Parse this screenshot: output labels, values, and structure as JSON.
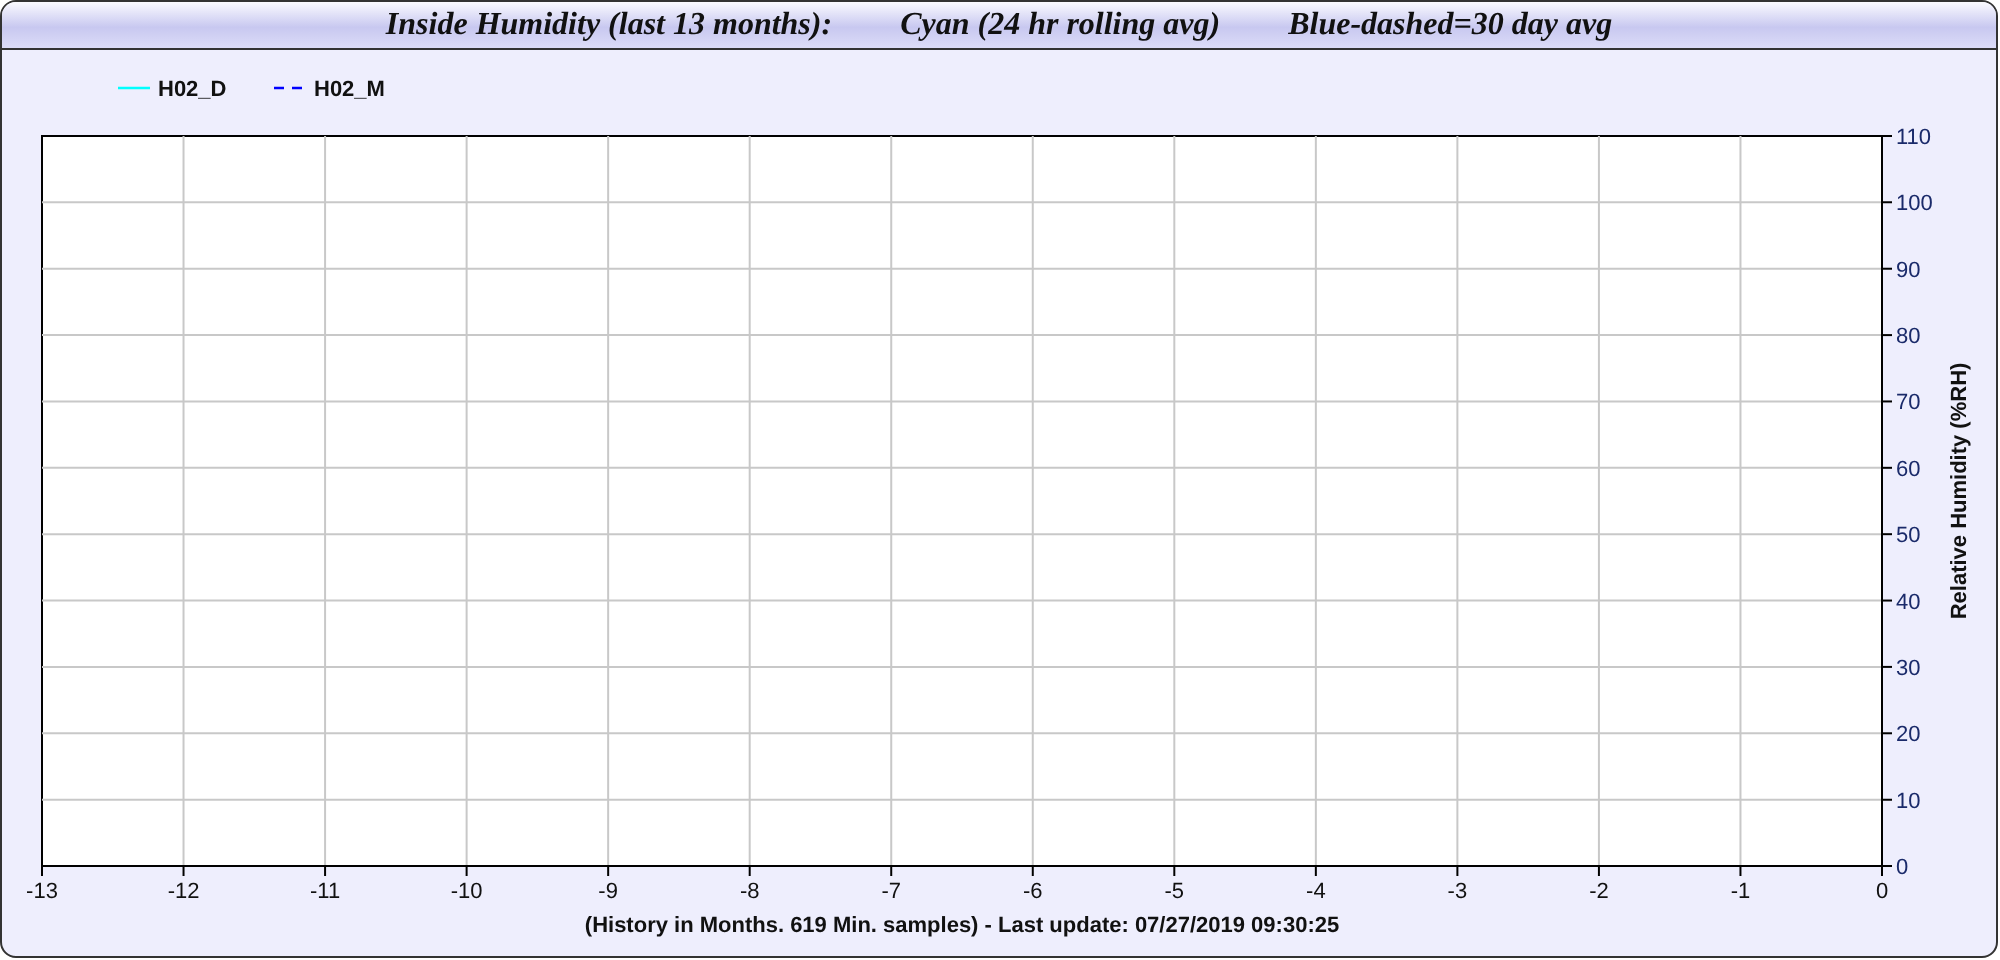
{
  "title": [
    "Inside Humidity (last 13 months):",
    "Cyan (24 hr rolling avg)",
    "Blue-dashed=30 day avg"
  ],
  "chart": {
    "legend": [
      {
        "dashed": false
      },
      {
        "dashed": true
      }
    ],
    "chart_data": {
      "type": "line",
      "xlabel": "(History in Months. 619 Min. samples) - Last update: 07/27/2019 09:30:25",
      "ylabel": "Relative Humidity (%RH)",
      "grid": true,
      "categories": [
        "-13",
        "-12",
        "-11",
        "-10",
        "-9",
        "-8",
        "-7",
        "-6",
        "-5",
        "-4",
        "-3",
        "-2",
        "-1",
        "0"
      ],
      "ylim": [
        0,
        110
      ],
      "yticks": [
        0,
        10,
        20,
        30,
        40,
        50,
        60,
        70,
        80,
        90,
        100,
        110
      ],
      "series": [
        {
          "name": "H02_D",
          "color": "#00ffff",
          "values": [
            null,
            null,
            null,
            null,
            null,
            null,
            null,
            null,
            null,
            null,
            null,
            null,
            null,
            null
          ]
        },
        {
          "name": "H02_M",
          "color": "#0000ff",
          "values": [
            null,
            null,
            null,
            null,
            null,
            null,
            null,
            null,
            null,
            null,
            null,
            null,
            null,
            null
          ]
        }
      ]
    }
  }
}
